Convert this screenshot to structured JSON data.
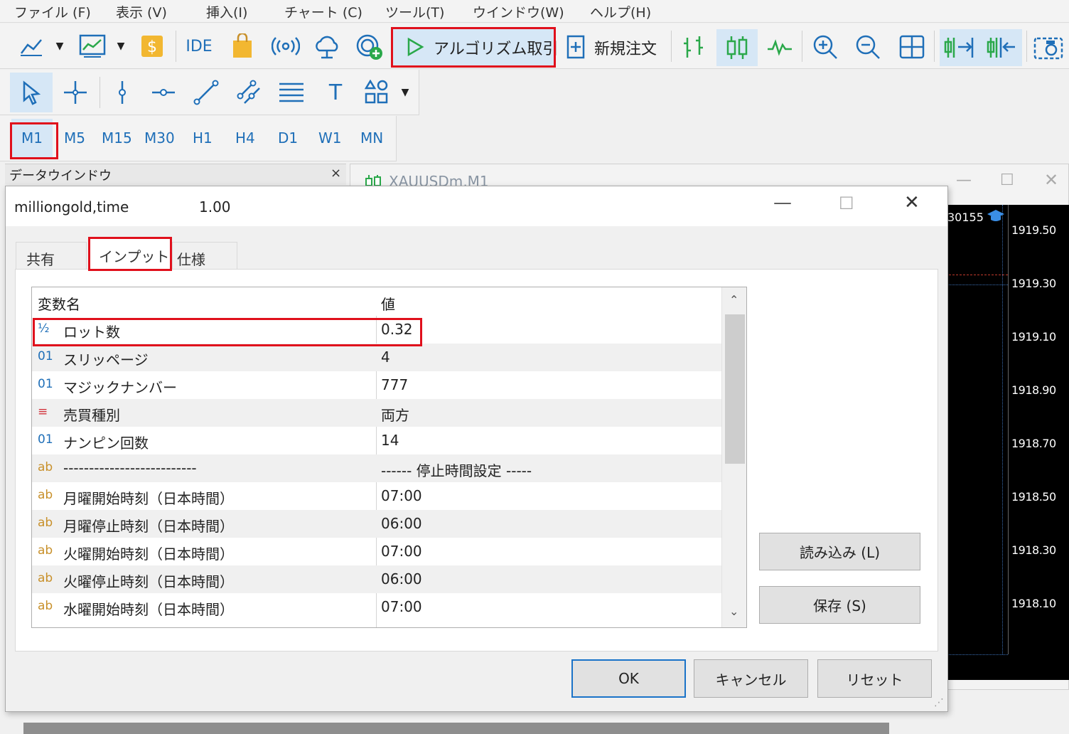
{
  "menu": [
    "ファイル (F)",
    "表示 (V)",
    "挿入(I)",
    "チャート (C)",
    "ツール(T)",
    "ウインドウ(W)",
    "ヘルプ(H)"
  ],
  "toolbar": {
    "ide_label": "IDE",
    "algo_label": "アルゴリズム取引",
    "new_order_label": "新規注文"
  },
  "timeframes": [
    "M1",
    "M5",
    "M15",
    "M30",
    "H1",
    "H4",
    "D1",
    "W1",
    "MN"
  ],
  "selected_timeframe": "M1",
  "data_window": {
    "title": "データウインドウ",
    "close": "×"
  },
  "chart": {
    "title": "XAUUSDm,M1",
    "badge": "30155",
    "prices": [
      "1919.50",
      "1919.30",
      "1919.10",
      "1918.90",
      "1918.70",
      "1918.50",
      "1918.30",
      "1918.10"
    ]
  },
  "dialog": {
    "title": "milliongold,time",
    "version": "1.00",
    "tabs": [
      "共有",
      "インプット",
      "仕様"
    ],
    "active_tab": "インプット",
    "columns": [
      "変数名",
      "値"
    ],
    "rows": [
      {
        "type": "½",
        "type_color": "#1f6fb8",
        "name": "ロット数",
        "value": "0.32"
      },
      {
        "type": "01",
        "type_color": "#1f6fb8",
        "name": "スリッページ",
        "value": "4"
      },
      {
        "type": "01",
        "type_color": "#1f6fb8",
        "name": "マジックナンバー",
        "value": "777"
      },
      {
        "type": "≡",
        "type_color": "#d2343c",
        "name": "売買種別",
        "value": "両方"
      },
      {
        "type": "01",
        "type_color": "#1f6fb8",
        "name": "ナンピン回数",
        "value": "14"
      },
      {
        "type": "ab",
        "type_color": "#c8902a",
        "name": "--------------------------",
        "value": "------ 停止時間設定 -----"
      },
      {
        "type": "ab",
        "type_color": "#c8902a",
        "name": "月曜開始時刻（日本時間）",
        "value": "07:00"
      },
      {
        "type": "ab",
        "type_color": "#c8902a",
        "name": "月曜停止時刻（日本時間）",
        "value": "06:00"
      },
      {
        "type": "ab",
        "type_color": "#c8902a",
        "name": "火曜開始時刻（日本時間）",
        "value": "07:00"
      },
      {
        "type": "ab",
        "type_color": "#c8902a",
        "name": "火曜停止時刻（日本時間）",
        "value": "06:00"
      },
      {
        "type": "ab",
        "type_color": "#c8902a",
        "name": "水曜開始時刻（日本時間）",
        "value": "07:00"
      }
    ],
    "buttons": {
      "load": "読み込み (L)",
      "save": "保存 (S)",
      "ok": "OK",
      "cancel": "キャンセル",
      "reset": "リセット"
    }
  },
  "colors": {
    "accent": "#1f6fb8",
    "highlight": "#e0101c",
    "chart_bg": "#000000"
  }
}
